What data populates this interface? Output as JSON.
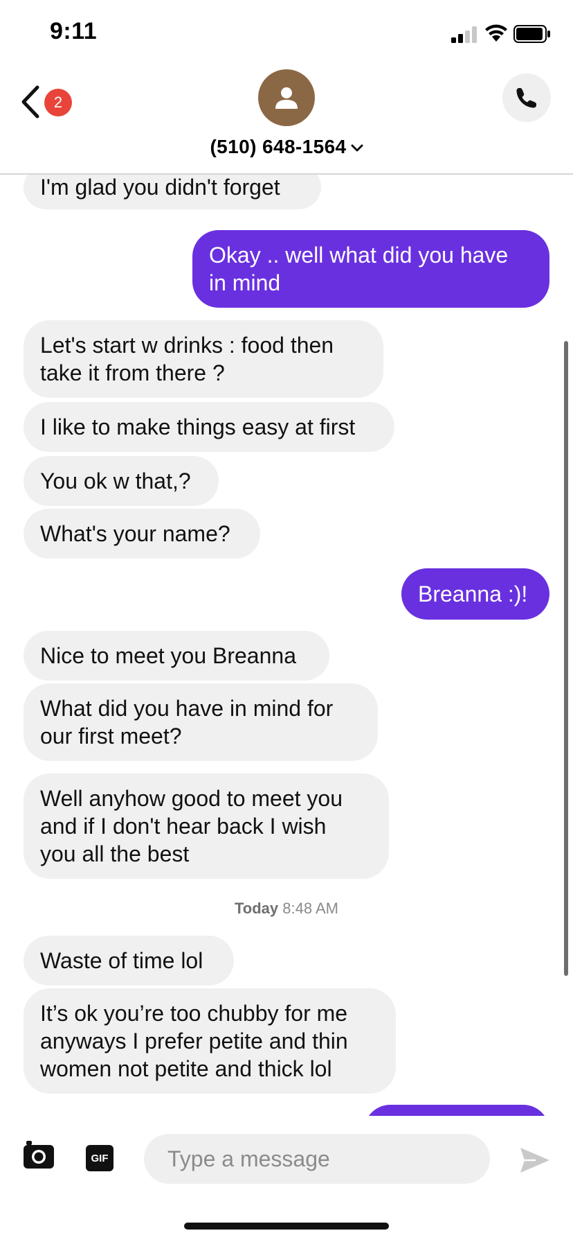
{
  "status_bar": {
    "time": "9:11"
  },
  "header": {
    "back_badge": "2",
    "contact": "(510) 648-1564"
  },
  "messages": [
    {
      "from": "them",
      "text": "I'm glad you didn't forget"
    },
    {
      "from": "me",
      "lines": [
        "Okay .. well what did you have",
        "in mind"
      ]
    },
    {
      "from": "them",
      "lines": [
        "Let's start w drinks : food then",
        "take it from there ?"
      ]
    },
    {
      "from": "them",
      "text": "I like to make things easy at first"
    },
    {
      "from": "them",
      "text": "You ok w that,?"
    },
    {
      "from": "them",
      "text": "What's your name?"
    },
    {
      "from": "me",
      "text": "Breanna :)!"
    },
    {
      "from": "them",
      "text": "Nice to meet you Breanna"
    },
    {
      "from": "them",
      "lines": [
        "What did you have in mind for",
        "our first meet?"
      ]
    },
    {
      "from": "them",
      "lines": [
        "Well anyhow good to meet you",
        "and if I don't hear back I wish",
        "you all the best"
      ]
    },
    {
      "from": "them",
      "text": "Waste of time lol"
    },
    {
      "from": "them",
      "lines": [
        "It’s ok you’re too chubby for me",
        "anyways I prefer petite and thin",
        "women not petite and thick lol"
      ]
    }
  ],
  "timestamp": {
    "day": "Today",
    "time": "8:48 AM"
  },
  "composer": {
    "gif_label": "GIF",
    "placeholder": "Type a message"
  },
  "colors": {
    "outgoing_bubble": "#6930df",
    "incoming_bubble": "#f0f0f0",
    "badge": "#e8443a",
    "avatar": "#8b6845"
  },
  "icons": [
    "back-chevron-icon",
    "person-icon",
    "phone-icon",
    "chevron-down-icon",
    "camera-icon",
    "send-icon",
    "signal-icon",
    "wifi-icon",
    "battery-icon"
  ]
}
